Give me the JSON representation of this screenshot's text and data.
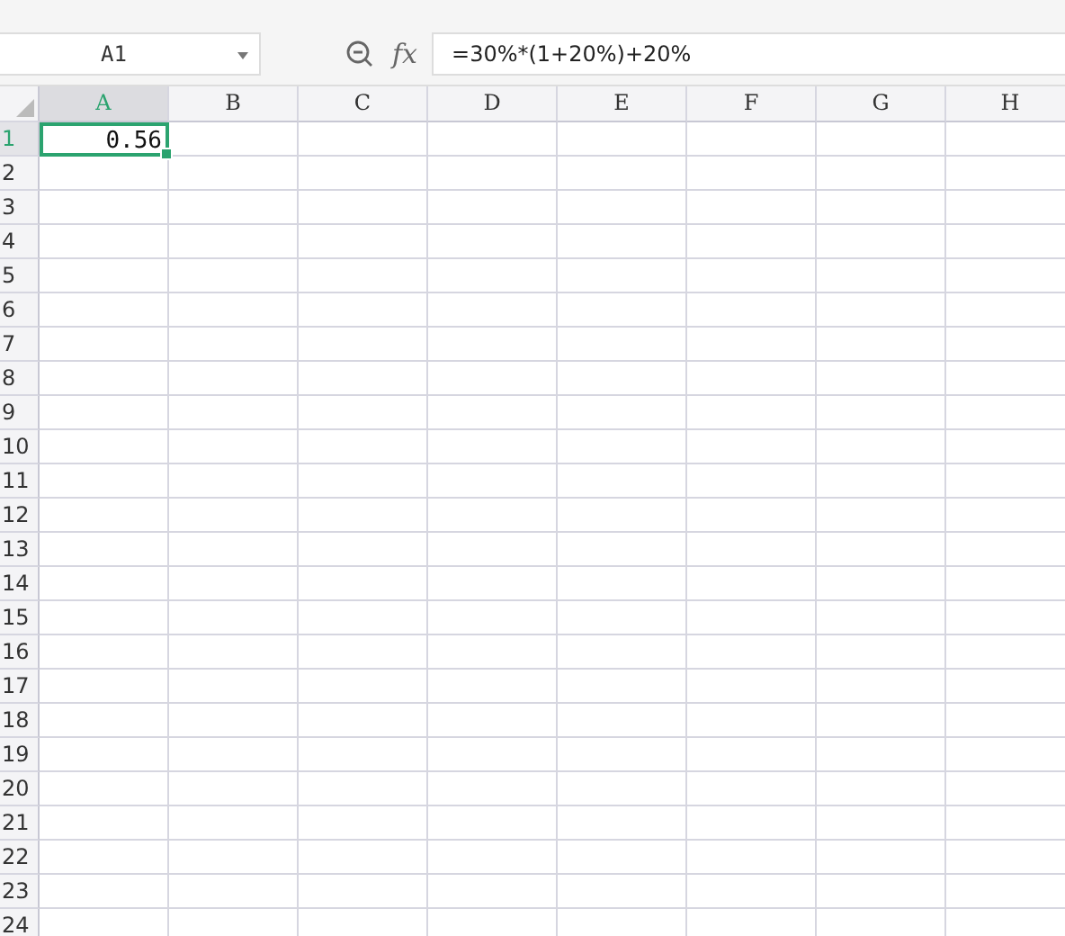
{
  "name_box": {
    "value": "A1"
  },
  "formula_bar": {
    "fx_label": "fx",
    "value": "=30%*(1+20%)+20%"
  },
  "columns": [
    {
      "label": "A",
      "selected": true
    },
    {
      "label": "B",
      "selected": false
    },
    {
      "label": "C",
      "selected": false
    },
    {
      "label": "D",
      "selected": false
    },
    {
      "label": "E",
      "selected": false
    },
    {
      "label": "F",
      "selected": false
    },
    {
      "label": "G",
      "selected": false
    },
    {
      "label": "H",
      "selected": false
    }
  ],
  "rows": [
    {
      "label": "1",
      "selected": true,
      "cells": [
        {
          "value": "0.56",
          "selected": true
        }
      ]
    },
    {
      "label": "2",
      "selected": false
    },
    {
      "label": "3",
      "selected": false
    },
    {
      "label": "4",
      "selected": false
    },
    {
      "label": "5",
      "selected": false
    },
    {
      "label": "6",
      "selected": false
    },
    {
      "label": "7",
      "selected": false
    },
    {
      "label": "8",
      "selected": false
    },
    {
      "label": "9",
      "selected": false
    },
    {
      "label": "10",
      "selected": false
    },
    {
      "label": "11",
      "selected": false
    },
    {
      "label": "12",
      "selected": false
    },
    {
      "label": "13",
      "selected": false
    },
    {
      "label": "14",
      "selected": false
    },
    {
      "label": "15",
      "selected": false
    },
    {
      "label": "16",
      "selected": false
    },
    {
      "label": "17",
      "selected": false
    },
    {
      "label": "18",
      "selected": false
    },
    {
      "label": "19",
      "selected": false
    },
    {
      "label": "20",
      "selected": false
    },
    {
      "label": "21",
      "selected": false
    },
    {
      "label": "22",
      "selected": false
    },
    {
      "label": "23",
      "selected": false
    },
    {
      "label": "24",
      "selected": false
    }
  ]
}
